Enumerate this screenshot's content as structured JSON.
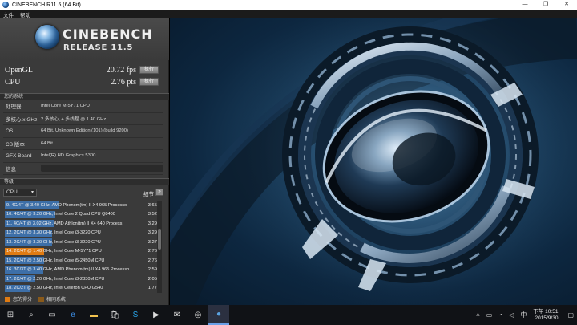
{
  "window": {
    "title": "CINEBENCH R11.5 (64 Bit)",
    "minimize": "—",
    "maximize": "❐",
    "close": "✕"
  },
  "menu": [
    "文件",
    "帮助"
  ],
  "logo": {
    "title": "CINEBENCH",
    "release": "RELEASE 11.5"
  },
  "scores": {
    "opengl": {
      "label": "OpenGL",
      "value": "20.72 fps",
      "button": "执行"
    },
    "cpu": {
      "label": "CPU",
      "value": "2.76 pts",
      "button": "执行"
    }
  },
  "system": {
    "header": "您的系统",
    "rows": [
      {
        "key": "处理器",
        "value": "Intel Core M-5Y71 CPU"
      },
      {
        "key": "多核心 x GHz",
        "value": "2 多核心, 4 多线程 @ 1.40 GHz"
      },
      {
        "key": "OS",
        "value": "64 Bit, Unknown Edition (101) (build 9200)"
      },
      {
        "key": "CB 版本",
        "value": "64 Bit"
      },
      {
        "key": "GFX Board",
        "value": "Intel(R) HD Graphics 5300"
      },
      {
        "key": "信息",
        "value": ""
      }
    ]
  },
  "ranking": {
    "header": "等级",
    "select": "CPU",
    "details_label": "细节",
    "details_button": "»",
    "items": [
      {
        "label": "9. 4C/4T @ 3.40 GHz, AMD Phenom(tm) II X4 965 Processo",
        "score": "3.65",
        "fraction": 0.35,
        "mine": false
      },
      {
        "label": "10. 4C/4T @ 3.20 GHz, Intel Core 2 Quad CPU Q8400",
        "score": "3.52",
        "fraction": 0.33,
        "mine": false
      },
      {
        "label": "11. 4C/4T @ 3.02 GHz, AMD Athlon(tm) II X4 640 Process",
        "score": "3.29",
        "fraction": 0.32,
        "mine": false
      },
      {
        "label": "12. 2C/4T @ 3.30 GHz,  Intel Core i3-3220 CPU",
        "score": "3.29",
        "fraction": 0.31,
        "mine": false
      },
      {
        "label": "13. 2C/4T @ 3.30 GHz,  Intel Core i3-3220 CPU",
        "score": "3.27",
        "fraction": 0.31,
        "mine": false
      },
      {
        "label": "14. 2C/4T @ 1.40 GHz, Intel Core M-5Y71 CPU",
        "score": "2.76",
        "fraction": 0.26,
        "mine": true
      },
      {
        "label": "15. 2C/4T @ 2.50 GHz, Intel Core i5-2450M CPU",
        "score": "2.76",
        "fraction": 0.26,
        "mine": false
      },
      {
        "label": "16. 3C/3T @ 3.40 GHz, AMD Phenom(tm) II X4 965 Processo",
        "score": "2.59",
        "fraction": 0.25,
        "mine": false
      },
      {
        "label": "17. 2C/4T @ 2.20 GHz,  Intel Core i3-2330M CPU",
        "score": "2.05",
        "fraction": 0.2,
        "mine": false
      },
      {
        "label": "18. 2C/2T @ 2.50 GHz,  Intel Celeron CPU G540",
        "score": "1.77",
        "fraction": 0.17,
        "mine": false
      }
    ]
  },
  "legend": [
    {
      "label": "您的得分",
      "color": "#e07b12"
    },
    {
      "label": "相同系统",
      "color": "#8a5a1a"
    }
  ],
  "colors": {
    "bar": "#3d6fa8",
    "mine": "#e07b12"
  },
  "taskbar": {
    "icons": [
      "windows-icon",
      "search-icon",
      "task-view-icon",
      "edge-icon",
      "file-explorer-icon",
      "store-icon",
      "skype-icon",
      "media-icon",
      "mail-icon",
      "app-icon",
      "cinebench-icon"
    ],
    "time": "下午 10:51",
    "date": "2015/9/30"
  }
}
